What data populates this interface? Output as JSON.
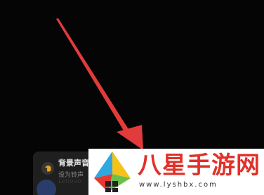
{
  "background_caption": "",
  "notification": {
    "title": "背景声音",
    "subtitle": "设为铃声",
    "faint_line": "Lenovo",
    "icon": "music-note-icon"
  },
  "bottom_text": "",
  "watermark": {
    "title": "八星手游网",
    "url": "www.lyshbx.com",
    "logo": "colorful-kite-logo"
  },
  "annotation": {
    "shape": "arrow-icon",
    "color": "#e23b3b"
  },
  "colors": {
    "background": "#050505",
    "card": "#1f1f1f",
    "watermark_red": "#e0312a",
    "arrow_red": "#e23b3b"
  }
}
